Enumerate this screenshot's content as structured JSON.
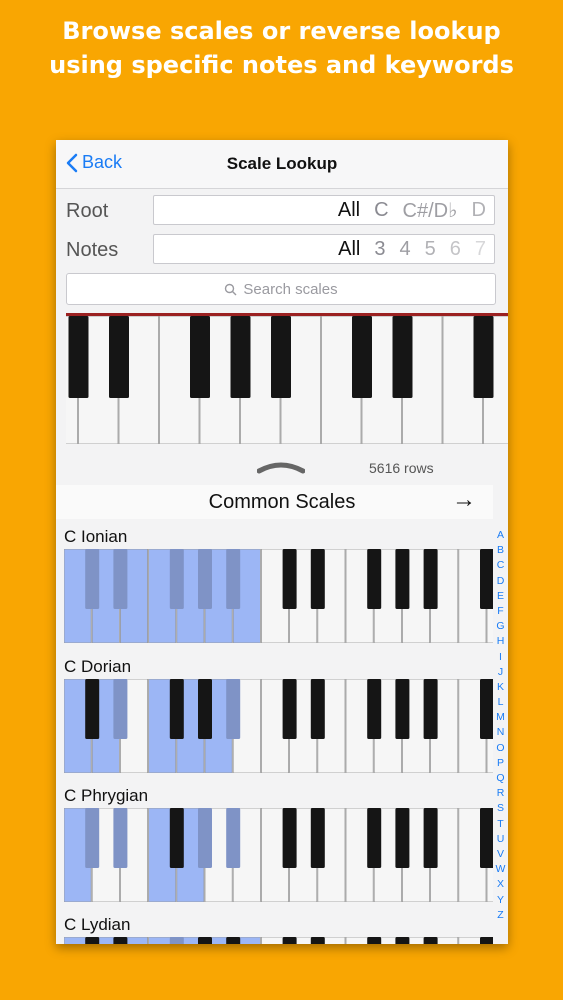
{
  "promo": {
    "line1": "Browse scales or reverse lookup",
    "line2": "using specific notes and keywords"
  },
  "navbar": {
    "back_label": "Back",
    "title": "Scale Lookup"
  },
  "root": {
    "label": "Root",
    "options": [
      {
        "text": "All",
        "active": true
      },
      {
        "text": "C",
        "active": false
      },
      {
        "text": "C#/D♭",
        "active": false
      },
      {
        "text": "D",
        "active": false
      }
    ]
  },
  "notes": {
    "label": "Notes",
    "options": [
      {
        "text": "All",
        "active": true
      },
      {
        "text": "3",
        "active": false
      },
      {
        "text": "4",
        "active": false
      },
      {
        "text": "5",
        "active": false
      },
      {
        "text": "6",
        "active": false
      },
      {
        "text": "7",
        "active": false
      }
    ]
  },
  "search": {
    "placeholder": "Search scales"
  },
  "row_count": "5616 rows",
  "section": {
    "title": "Common Scales",
    "arrow": "→"
  },
  "scales": [
    {
      "name": "C Ionian",
      "highlighted_whites": [
        0,
        1,
        2,
        3,
        4,
        5,
        6
      ],
      "highlighted_blacks": [
        0,
        1,
        2,
        3,
        4
      ]
    },
    {
      "name": "C Dorian",
      "highlighted_whites": [
        0,
        1,
        3,
        4,
        5
      ],
      "highlighted_blacks": [
        1,
        4
      ]
    },
    {
      "name": "C Phrygian",
      "highlighted_whites": [
        0,
        3,
        4
      ],
      "highlighted_blacks": [
        0,
        1,
        3,
        4
      ]
    },
    {
      "name": "C Lydian",
      "highlighted_whites": [
        0,
        1,
        2,
        3,
        4,
        5,
        6
      ],
      "highlighted_blacks": [
        2
      ]
    }
  ],
  "index_letters": [
    "A",
    "B",
    "C",
    "D",
    "E",
    "F",
    "G",
    "H",
    "I",
    "J",
    "K",
    "L",
    "M",
    "N",
    "O",
    "P",
    "Q",
    "R",
    "S",
    "T",
    "U",
    "V",
    "W",
    "X",
    "Y",
    "Z"
  ],
  "colors": {
    "promo_background": "#F9A602",
    "accent": "#1A7CF5",
    "highlight": "#9CB6F5"
  }
}
